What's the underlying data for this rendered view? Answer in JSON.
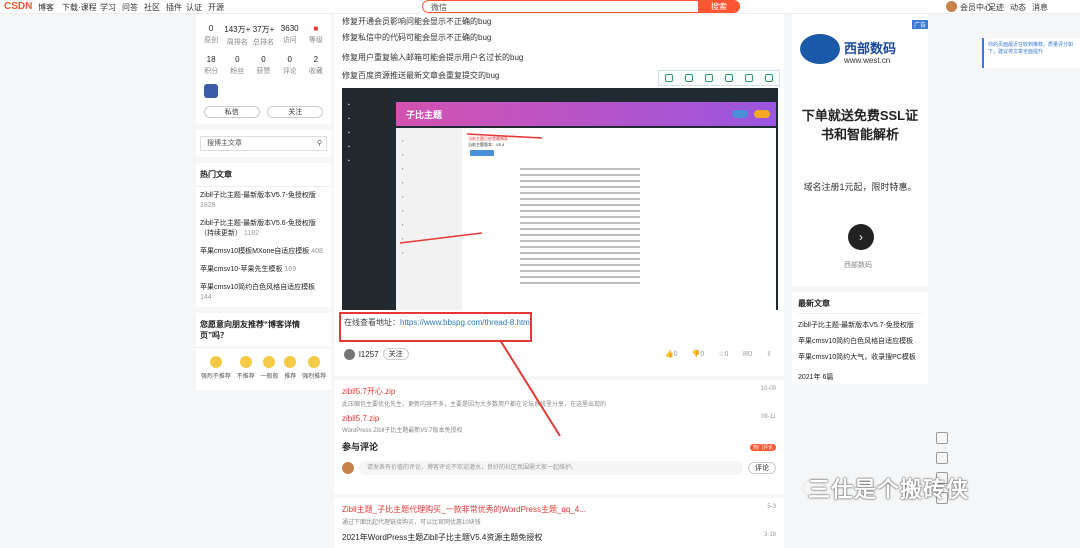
{
  "topbar": {
    "logo": "CSDN",
    "nav": [
      "博客",
      "下载·课程",
      "学习",
      "问答",
      "社区",
      "插件",
      "认证",
      "开源"
    ],
    "search_text": "微信",
    "search_btn": "搜索",
    "right": [
      "会员中心",
      "足迹",
      "动态",
      "消息"
    ]
  },
  "profile": {
    "stats_row1": [
      {
        "n": "0",
        "l": "原创"
      },
      {
        "n": "143万+",
        "l": "周排名"
      },
      {
        "n": "37万+",
        "l": "总排名"
      },
      {
        "n": "3630",
        "l": "访问"
      },
      {
        "n": "",
        "l": "等级"
      }
    ],
    "stats_row2": [
      {
        "n": "18",
        "l": "积分"
      },
      {
        "n": "0",
        "l": "粉丝"
      },
      {
        "n": "0",
        "l": "获赞"
      },
      {
        "n": "0",
        "l": "评论"
      },
      {
        "n": "2",
        "l": "收藏"
      }
    ],
    "btn_msg": "私信",
    "btn_follow": "关注",
    "search_placeholder": "搜博主文章"
  },
  "hot": {
    "title": "热门文章",
    "items": [
      {
        "t": "Zibll子比主题-最新版本V5.7-免授权版",
        "v": "1828"
      },
      {
        "t": "Zibll子比主题-最新版本V5.6-免授权版（持续更新）",
        "v": "1182"
      },
      {
        "t": "苹果cmsv10模板MXone自适应模板",
        "v": "408"
      },
      {
        "t": "苹果cmsv10-苹果先生模板",
        "v": "169"
      },
      {
        "t": "苹果cmsv10简约白色风格自适应模板",
        "v": "144"
      }
    ]
  },
  "survey": {
    "title": "您愿意向朋友推荐“博客详情页”吗？",
    "options": [
      "强烈不推荐",
      "不推荐",
      "一般般",
      "推荐",
      "强烈推荐"
    ]
  },
  "article": {
    "lines": [
      "修复开通会员影响问能会显示不正确的bug",
      "修复私信中的代码可能会显示不正确的bug",
      "修复用户重复输入邮箱可能会提示用户名过长的bug",
      "修复百度资源推送最新文章会重复提交的bug"
    ],
    "online_label": "在线查看地址：",
    "online_url": "https://www.bbspg.com/thread-8.htm",
    "shot_title": "子比主题",
    "shot_notice": "当前主题已经是最新版",
    "shot_version": "当前主题版本：V5.4",
    "author": "l1257",
    "follow": "关注"
  },
  "related": [
    {
      "t": "zibll5.7开心.zip",
      "d": "此压缩包主要优化先生，更新内容不多，主要是因为大多数用户都在论坛系统里分享，在这里出现的",
      "dt": "10-09"
    },
    {
      "t": "zibll5.7.zip",
      "d": "WordPress Zibll子比主题最新V5.7版本免授权",
      "dt": "09-11"
    }
  ],
  "comments": {
    "title": "参与评论",
    "placeholder": "请发表有价值的评论，博客评论不欢迎灌水，良好的社区氛围需大家一起维护。",
    "btn": "评论",
    "hot": "热门评论"
  },
  "related2": [
    {
      "t": "Zibll主题_子比主题代理购买_一款非常优秀的WordPress主题_qq_4...",
      "d": "通过下面比起代理链接购买，可以比官网优惠10块钱",
      "dt": "5-3"
    },
    {
      "t": "2021年WordPress主题Zibll子比主题V5.4资源主题免授权",
      "d": "",
      "dt": "3-18"
    }
  ],
  "ad": {
    "brand": "西部数码",
    "url": "www.west.cn",
    "big": "下单就送免费SSL证书和智能解析",
    "sub": "域名注册1元起，限时特惠。",
    "src": "西部数码",
    "tag": "广告"
  },
  "recent": {
    "title": "最新文章",
    "items": [
      "Zibll子比主题-最新版本V5.7-免授权版",
      "苹果cmsv10简约白色风格自适应模板",
      "苹果cmsv10简约大气，收录搜PC模板"
    ],
    "date": "2021年",
    "count": "6篇"
  },
  "tip": "你的页面最近在收到推荐，质量评分如下，建议将文章全面提升",
  "watermark": "三仕是个搬砖侠",
  "colors": {
    "brand": "#fc5531",
    "link": "#2a7ac0",
    "red": "#e53935"
  }
}
